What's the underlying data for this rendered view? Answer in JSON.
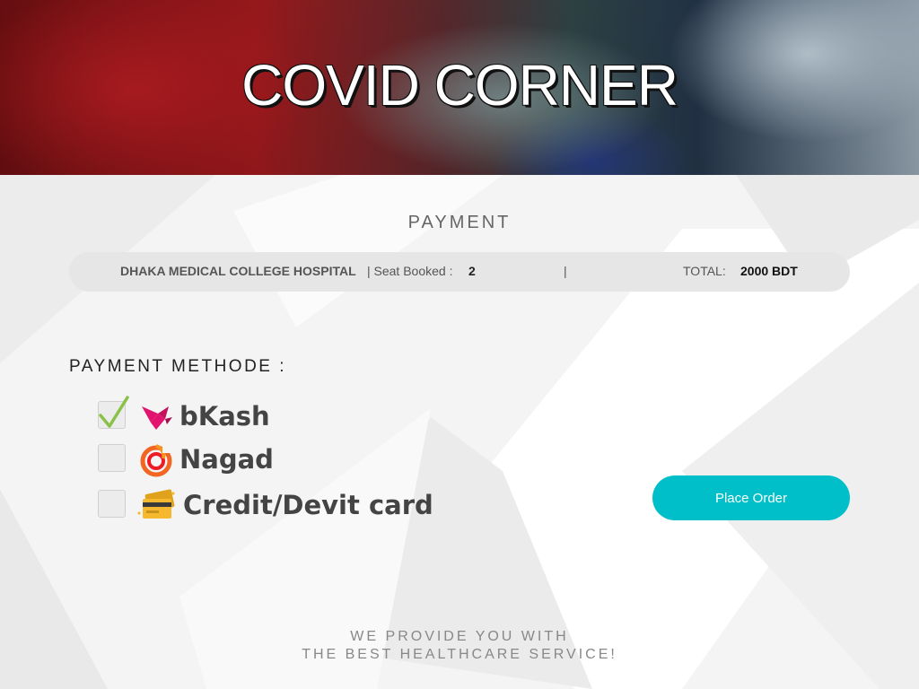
{
  "hero": {
    "title": "COVID CORNER"
  },
  "payment": {
    "heading": "PAYMENT",
    "hospital": "DHAKA MEDICAL COLLEGE HOSPITAL",
    "seat_label": "|  Seat Booked :",
    "seat_value": "2",
    "separator": "|",
    "total_label": "TOTAL:",
    "total_value": "2000 BDT"
  },
  "methods": {
    "label": "PAYMENT METHODE :",
    "options": [
      {
        "label": "bKash",
        "checked": true,
        "icon": "bkash-bird-icon"
      },
      {
        "label": "Nagad",
        "checked": false,
        "icon": "nagad-logo-icon"
      },
      {
        "label": "Credit/Devit card",
        "checked": false,
        "icon": "credit-card-icon"
      }
    ]
  },
  "actions": {
    "place_order": "Place Order"
  },
  "footer": {
    "line1": "WE PROVIDE YOU WITH",
    "line2": "THE BEST HEALTHCARE SERVICE!"
  },
  "colors": {
    "accent": "#00bfc8",
    "check": "#8ac249",
    "bkash": "#e2136e",
    "nagad": "#f26522"
  }
}
